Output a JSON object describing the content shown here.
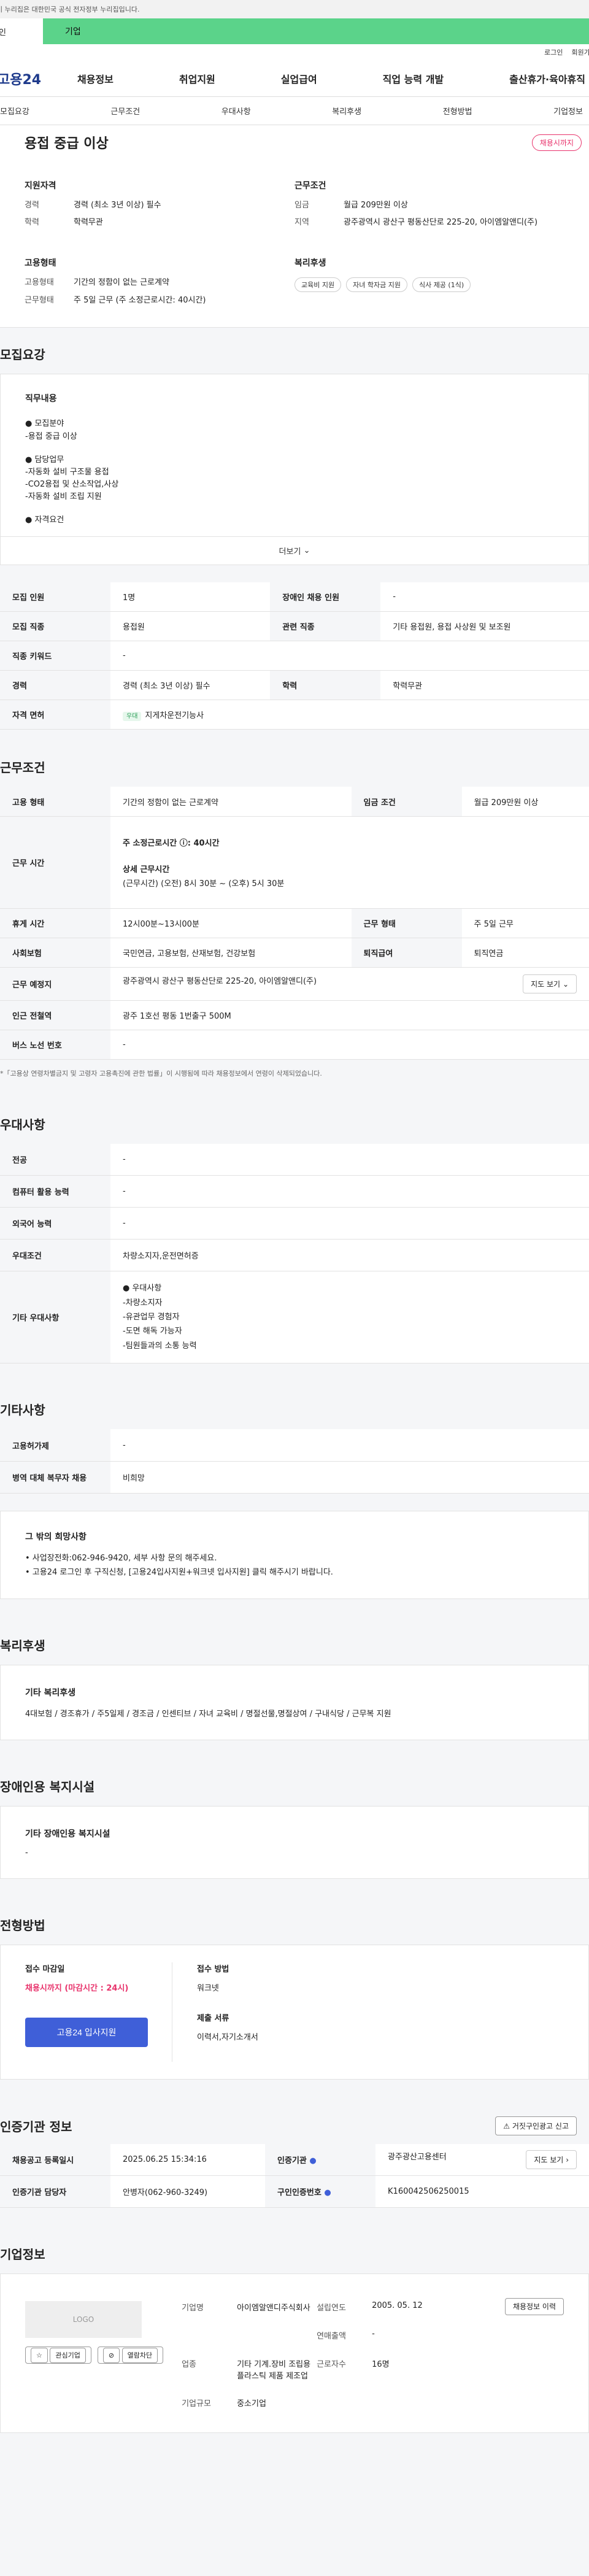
{
  "gov_notice": "이 누리집은 대한민국 공식 전자정부 누리집입니다.",
  "tabs": {
    "person": "개인",
    "business": "기업"
  },
  "util": {
    "login": "로그인",
    "signup": "회원가입"
  },
  "logo": "고용24",
  "gnb": [
    "채용정보",
    "취업지원",
    "실업급여",
    "직업 능력 개발",
    "출산휴가·육아휴직"
  ],
  "subtabs": [
    "모집요강",
    "근무조건",
    "우대사항",
    "복리후생",
    "전형방법",
    "기업정보"
  ],
  "summary": {
    "title": "용접 중급 이상",
    "badge": "채용시까지",
    "qual": {
      "heading": "지원자격",
      "career_k": "경력",
      "career_v": "경력 (최소 3년 이상) 필수",
      "edu_k": "학력",
      "edu_v": "학력무관"
    },
    "cond": {
      "heading": "근무조건",
      "pay_k": "임금",
      "pay_v": "월급 209만원 이상",
      "loc_k": "지역",
      "loc_v": "광주광역시 광산구 평동산단로 225-20, 아이엠알앤디(주)"
    },
    "emp": {
      "heading": "고용형태",
      "type_k": "고용형태",
      "type_v": "기간의 정함이 없는 근로계약",
      "shift_k": "근무형태",
      "shift_v": "주 5일 근무 (주 소정근로시간: 40시간)"
    },
    "welfare": {
      "heading": "복리후생",
      "chips": [
        "교육비 지원",
        "자녀 학자금 지원",
        "식사 제공 (1식)"
      ]
    }
  },
  "recruit": {
    "section_title": "모집요강",
    "content_heading": "직무내용",
    "lines": [
      "● 모집분야",
      "-용접 중급 이상",
      "",
      "● 담당업무",
      "-자동화 설비 구조물 용접",
      "-CO2용접 및 산소작업,사상",
      "-자동화 설비 조립 지원",
      "",
      "● 자격요건"
    ],
    "more": "더보기",
    "table": {
      "count_k": "모집 인원",
      "count_v": "1명",
      "disabled_k": "장애인 채용 인원",
      "disabled_v": "-",
      "job_k": "모집 직종",
      "job_v": "용접원",
      "rel_k": "관련 직종",
      "rel_v": "기타 용접원, 용접 사상원 및 보조원",
      "kw_k": "직종 키워드",
      "kw_v": "-",
      "career_k": "경력",
      "career_v": "경력 (최소 3년 이상) 필수",
      "edu_k": "학력",
      "edu_v": "학력무관",
      "lic_k": "자격 면허",
      "lic_badge": "우대",
      "lic_v": "지게차운전기능사"
    }
  },
  "work": {
    "section_title": "근무조건",
    "emp_k": "고용 형태",
    "emp_v": "기간의 정함이 없는 근로계약",
    "wage_k": "임금 조건",
    "wage_v": "월급 209만원 이상",
    "hours_k": "근무 시간",
    "hours_main": "주 소정근로시간 ⓘ: 40시간",
    "hours_detail_h": "상세 근무시간",
    "hours_detail": "(근무시간) (오전) 8시 30분 ~ (오후) 5시 30분",
    "break_k": "휴게 시간",
    "break_v": "12시00분~13시00분",
    "shift_k": "근무 형태",
    "shift_v": "주 5일 근무",
    "ins_k": "사회보험",
    "ins_v": "국민연금, 고용보험, 산재보험, 건강보험",
    "sev_k": "퇴직급여",
    "sev_v": "퇴직연금",
    "place_k": "근무 예정지",
    "place_v": "광주광역시 광산구 평동산단로 225-20, 아이엠알앤디(주)",
    "map": "지도 보기",
    "station_k": "인근 전철역",
    "station_v": "광주 1호선 평동 1번출구 500M",
    "bus_k": "버스 노선 번호",
    "bus_v": "-",
    "note": "*「고용상 연령차별금지 및 고령자 고용촉진에 관한 법률」이 시행됨에 따라 채용정보에서 연령이 삭제되었습니다."
  },
  "pref": {
    "section_title": "우대사항",
    "major_k": "전공",
    "major_v": "-",
    "pc_k": "컴퓨터 활용 능력",
    "pc_v": "-",
    "lang_k": "외국어 능력",
    "lang_v": "-",
    "cond_k": "우대조건",
    "cond_v": "차량소지자,운전면허증",
    "etc_k": "기타 우대사항",
    "etc_lines": [
      "● 우대사항",
      "-차량소지자",
      "-유관업무 경험자",
      "-도면 해독 가능자",
      "-팀원들과의 소통 능력"
    ]
  },
  "other": {
    "section_title": "기타사항",
    "disabled_k": "고용허가제",
    "disabled_v": "-",
    "mil_k": "병역 대체 복무자 채용",
    "mil_v": "비희망",
    "etc_heading": "그 밖의 희망사항",
    "etc_lines": [
      "• 사업장전화:062-946-9420, 세부 사항 문의 해주세요.",
      "• 고용24 로그인 후 구직신청, [고용24입사지원+워크넷 입사지원] 클릭 해주시기 바랍니다."
    ]
  },
  "benefit": {
    "section_title": "복리후생",
    "heading": "기타 복리후생",
    "text": "4대보험 / 경조휴가 / 주5일제 / 경조금 / 인센티브 / 자녀 교육비 / 명절선물,명절상여 / 구내식당 / 근무복 지원"
  },
  "facility": {
    "section_title": "장애인용 복지시설",
    "heading": "기타 장애인용 복지시설",
    "text": "-"
  },
  "selection": {
    "section_title": "전형방법",
    "deadline_h": "접수 마감일",
    "deadline_v": "채용시까지 (마감시간 : 24시)",
    "method_h": "접수 방법",
    "method_v": "워크넷",
    "docs_h": "제출 서류",
    "docs_v": "이력서,자기소개서",
    "apply": "고용24 입사지원"
  },
  "agency": {
    "section_title": "인증기관 정보",
    "report": "거짓구인광고 신고",
    "reg_k": "채용공고 등록일시",
    "reg_v": "2025.06.25 15:34:16",
    "org_k": "인증기관",
    "org_v": "광주광산고용센터",
    "map": "지도 보기",
    "mgr_k": "인증기관 담당자",
    "mgr_v": "안병자(062-960-3249)",
    "num_k": "구인인증번호",
    "num_v": "K160042506250015"
  },
  "company": {
    "section_title": "기업정보",
    "logo": "LOGO",
    "fav": "관심기업",
    "block": "열람차단",
    "name_k": "기업명",
    "name_v": "아이엠알앤디주식회사",
    "found_k": "설립연도",
    "found_v": "2005. 05. 12",
    "sales_k": "연매출액",
    "sales_v": "-",
    "ind_k": "업종",
    "ind_v": "기타 기계.장비 조립용 플라스틱 제품 제조업",
    "emp_k": "근로자수",
    "emp_v": "16명",
    "size_k": "기업규모",
    "size_v": "중소기업",
    "history": "채용정보 이력"
  }
}
